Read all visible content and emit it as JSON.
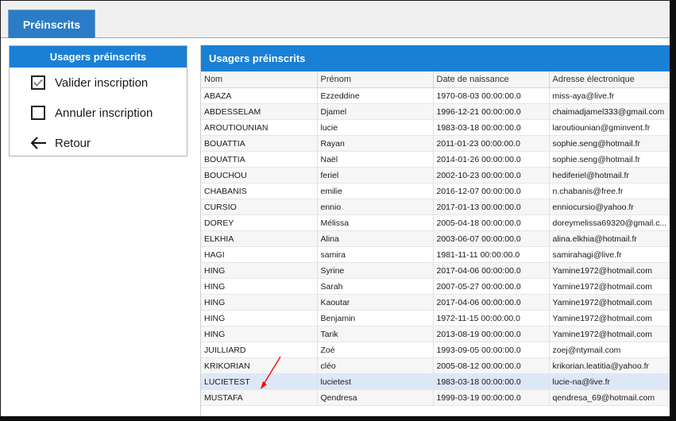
{
  "tab": {
    "label": "Préinscrits"
  },
  "left_panel": {
    "title": "Usagers préinscrits",
    "items": [
      {
        "label": "Valider inscription",
        "icon": "checked-checkbox-icon"
      },
      {
        "label": "Annuler inscription",
        "icon": "empty-checkbox-icon"
      },
      {
        "label": "Retour",
        "icon": "arrow-left-icon"
      }
    ]
  },
  "table": {
    "title": "Usagers préinscrits",
    "columns": [
      "Nom",
      "Prénom",
      "Date de naissance",
      "Adresse électronique"
    ],
    "selected_row": 18,
    "rows": [
      [
        "ABAZA",
        "Ezzeddine",
        "1970-08-03 00:00:00.0",
        "miss-aya@live.fr"
      ],
      [
        "ABDESSELAM",
        "Djamel",
        "1996-12-21 00:00:00.0",
        "chaimadjamel333@gmail.com"
      ],
      [
        "AROUTIOUNIAN",
        "lucie",
        "1983-03-18 00:00:00.0",
        "laroutiounian@gminvent.fr"
      ],
      [
        "BOUATTIA",
        "Rayan",
        "2011-01-23 00:00:00.0",
        "sophie.seng@hotmail.fr"
      ],
      [
        "BOUATTIA",
        "Naël",
        "2014-01-26 00:00:00.0",
        "sophie.seng@hotmail.fr"
      ],
      [
        "BOUCHOU",
        "feriel",
        "2002-10-23 00:00:00.0",
        "hediferiel@hotmail.fr"
      ],
      [
        "CHABANIS",
        "emilie",
        "2016-12-07 00:00:00.0",
        "n.chabanis@free.fr"
      ],
      [
        "CURSIO",
        "ennio",
        "2017-01-13 00:00:00.0",
        "enniocursio@yahoo.fr"
      ],
      [
        "DOREY",
        "Mélissa",
        "2005-04-18 00:00:00.0",
        "doreymelissa69320@gmail.c..."
      ],
      [
        "ELKHIA",
        "Alina",
        "2003-06-07 00:00:00.0",
        "alina.elkhia@hotmail.fr"
      ],
      [
        "HAGI",
        "samira",
        "1981-11-11 00:00:00.0",
        "samirahagi@live.fr"
      ],
      [
        "HING",
        "Syrine",
        "2017-04-06 00:00:00.0",
        "Yamine1972@hotmail.com"
      ],
      [
        "HING",
        "Sarah",
        "2007-05-27 00:00:00.0",
        "Yamine1972@hotmail.com"
      ],
      [
        "HING",
        "Kaoutar",
        "2017-04-06 00:00:00.0",
        "Yamine1972@hotmail.com"
      ],
      [
        "HING",
        "Benjamin",
        "1972-11-15 00:00:00.0",
        "Yamine1972@hotmail.com"
      ],
      [
        "HING",
        "Tarik",
        "2013-08-19 00:00:00.0",
        "Yamine1972@hotmail.com"
      ],
      [
        "JUILLIARD",
        "Zoé",
        "1993-09-05 00:00:00.0",
        "zoej@ntymail.com"
      ],
      [
        "KRIKORIAN",
        "cléo",
        "2005-08-12 00:00:00.0",
        "krikorian.leatitia@yahoo.fr"
      ],
      [
        "LUCIETEST",
        "lucietest",
        "1983-03-18 00:00:00.0",
        "lucie-na@live.fr"
      ],
      [
        "MUSTAFA",
        "Qendresa",
        "1999-03-19 00:00:00.0",
        "qendresa_69@hotmail.com"
      ]
    ]
  },
  "colors": {
    "accent": "#1a80d6",
    "tab": "#2a7cc7",
    "selected_row": "#dde8f7",
    "annotation_arrow": "#ff0000"
  }
}
